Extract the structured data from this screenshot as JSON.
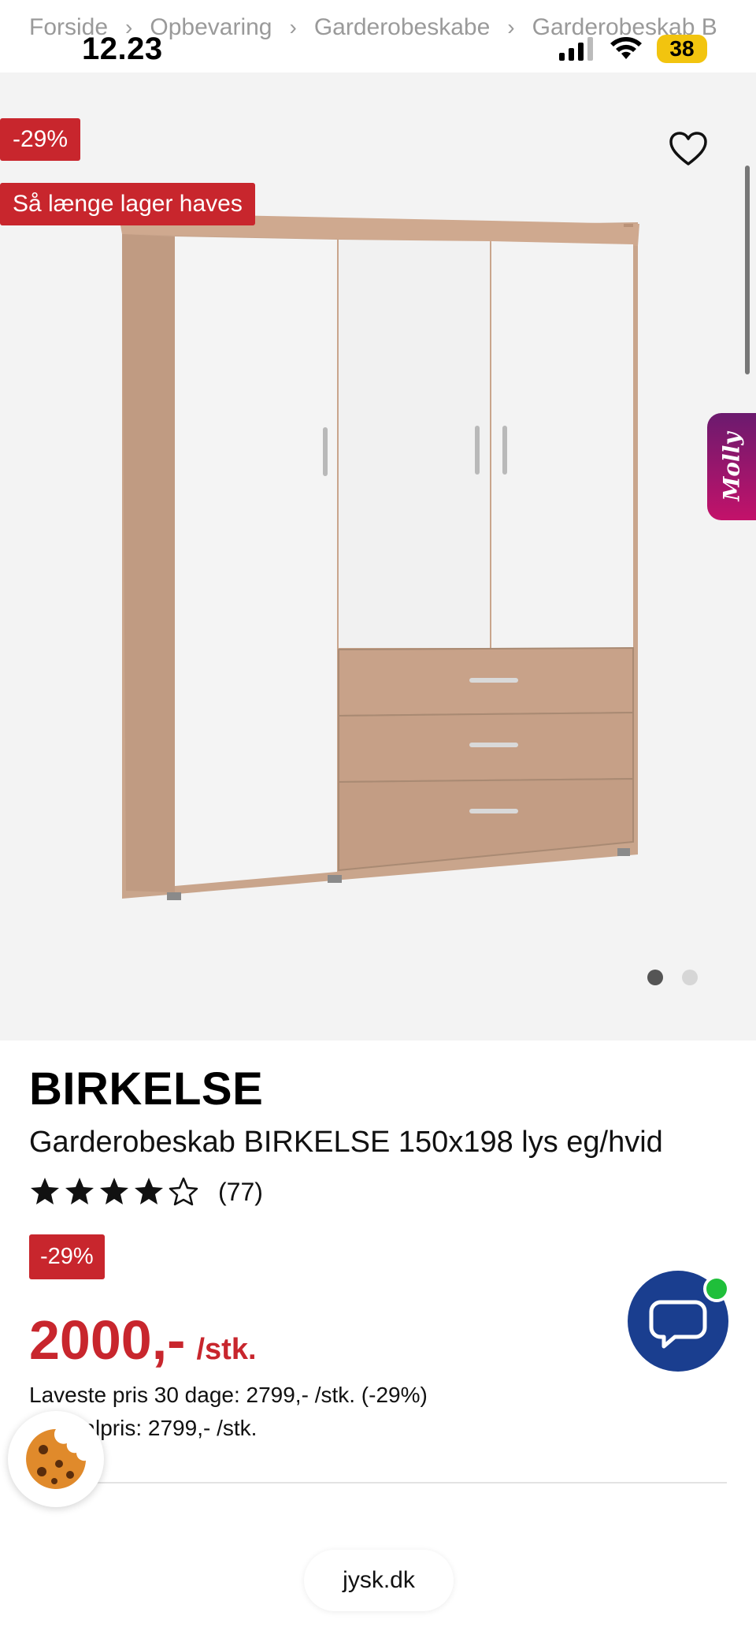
{
  "status": {
    "time": "12.23",
    "battery": "38"
  },
  "breadcrumb": [
    "Forside",
    "Opbevaring",
    "Garderobeskabe",
    "Garderobeskab B"
  ],
  "hero": {
    "badge_discount": "-29%",
    "badge_stock": "Så længe lager haves",
    "molly_label": "Molly",
    "slide_count": 2,
    "active_slide": 1
  },
  "product": {
    "brand": "BIRKELSE",
    "title": "Garderobeskab BIRKELSE 150x198 lys eg/hvid",
    "rating_stars": 4,
    "rating_max": 5,
    "review_count": "(77)",
    "discount_badge": "-29%",
    "price": "2000,-",
    "price_unit": "/stk.",
    "lowest_price_text": "Laveste pris 30 dage: 2799,- /stk. (-29%)",
    "normal_price_text": "Normalpris: 2799,- /stk."
  },
  "browser": {
    "url": "jysk.dk"
  },
  "colors": {
    "accent_red": "#c8262d",
    "chat_blue": "#1a3e8f",
    "online_green": "#1fbf3a"
  }
}
